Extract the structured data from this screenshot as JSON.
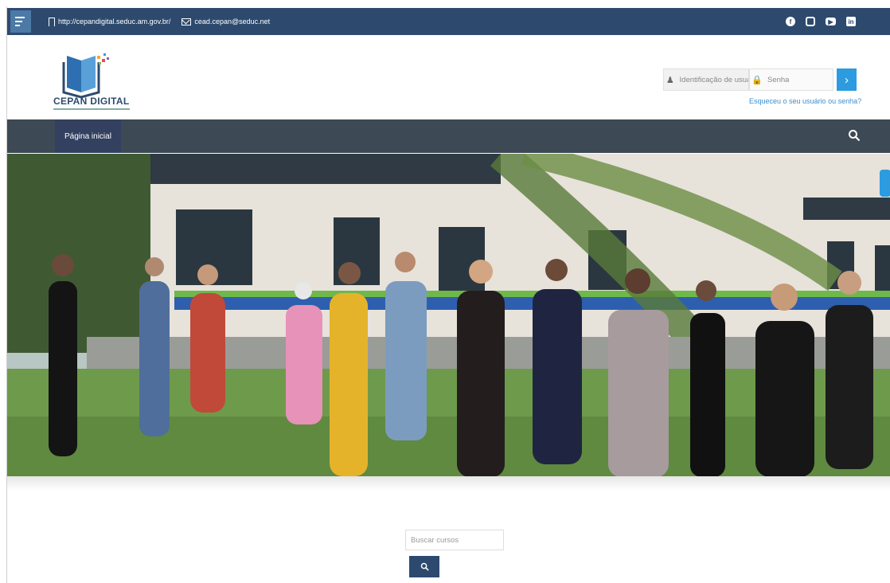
{
  "topbar": {
    "site_url": "http://cepandigital.seduc.am.gov.br/",
    "email": "cead.cepan@seduc.net",
    "social_icons": [
      "facebook-icon",
      "instagram-icon",
      "youtube-icon",
      "linkedin-icon"
    ]
  },
  "brand": {
    "name": "CEPAN DIGITAL"
  },
  "login": {
    "username_placeholder": "Identificação de usuário",
    "password_placeholder": "Senha",
    "forgot_link": "Esqueceu o seu usuário ou senha?"
  },
  "nav": {
    "home_label": "Página inicial"
  },
  "course_search": {
    "placeholder": "Buscar cursos"
  },
  "colors": {
    "topbar": "#2d4a6e",
    "navbar": "#3d4954",
    "accent": "#2c9be0",
    "link": "#3a8fd0"
  }
}
